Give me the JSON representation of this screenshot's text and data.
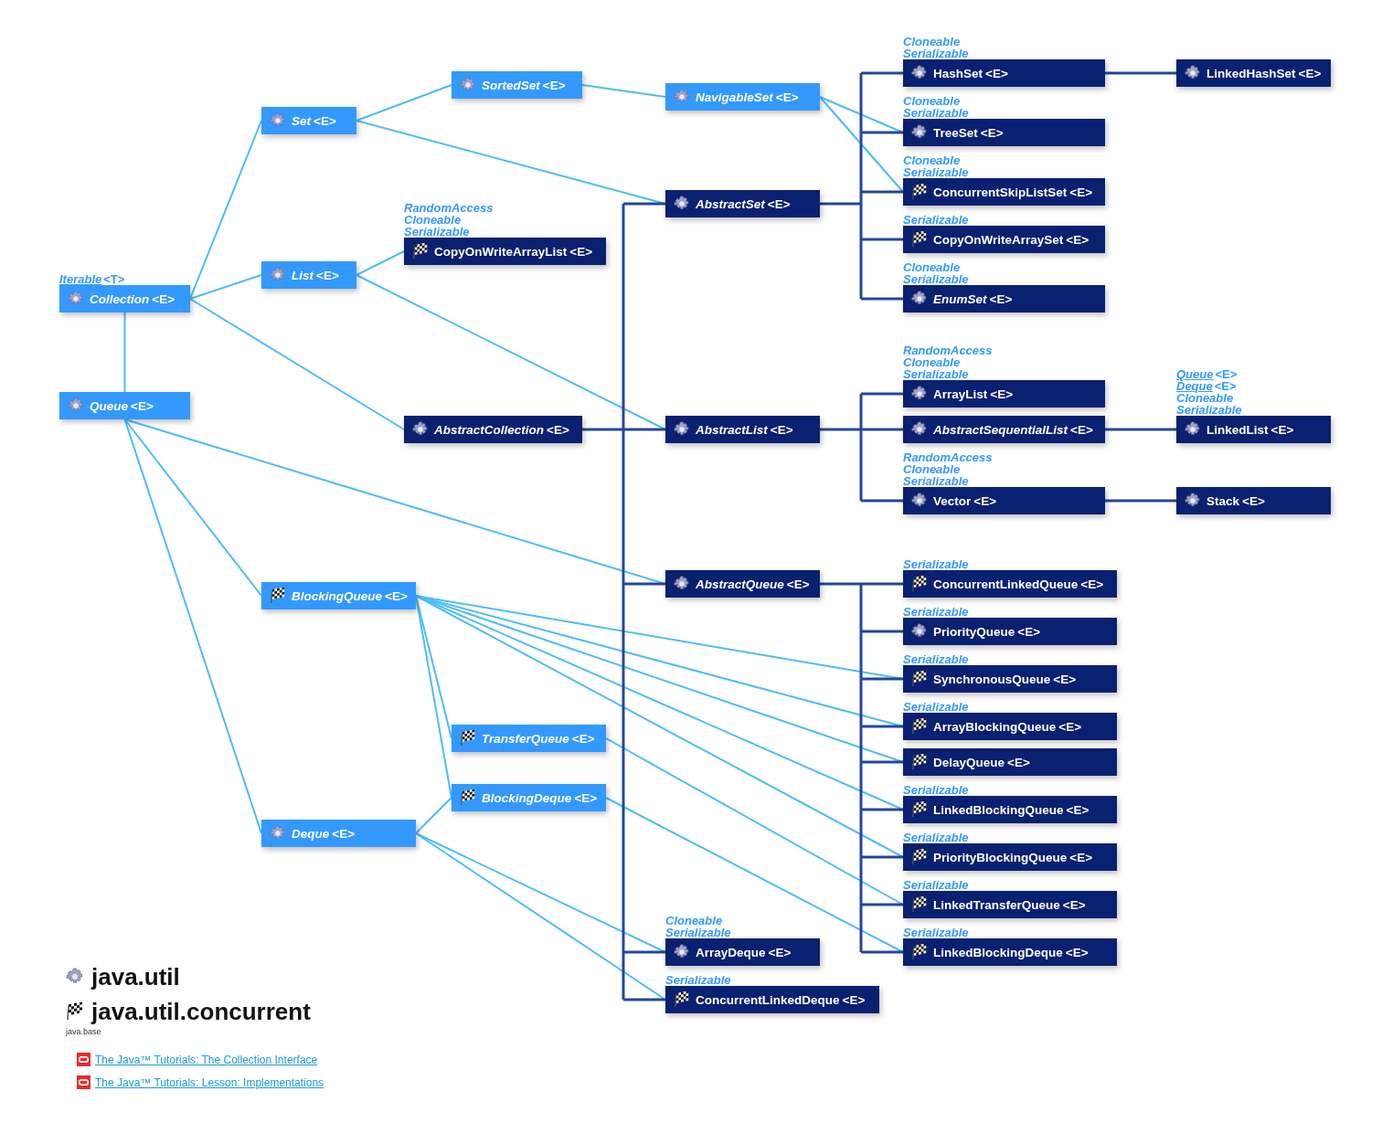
{
  "diagram": {
    "nodes": [
      {
        "name": "Collection",
        "type_params": "<E>",
        "kind": "interface",
        "concurrent": false,
        "supers": [
          {
            "text": "Iterable",
            "type_params": "<T>",
            "linked": true
          }
        ]
      },
      {
        "name": "Queue",
        "type_params": "<E>",
        "kind": "interface",
        "concurrent": false
      },
      {
        "name": "Set",
        "type_params": "<E>",
        "kind": "interface",
        "concurrent": false
      },
      {
        "name": "List",
        "type_params": "<E>",
        "kind": "interface",
        "concurrent": false
      },
      {
        "name": "SortedSet",
        "type_params": "<E>",
        "kind": "interface",
        "concurrent": false
      },
      {
        "name": "NavigableSet",
        "type_params": "<E>",
        "kind": "interface",
        "concurrent": false
      },
      {
        "name": "AbstractSet",
        "type_params": "<E>",
        "kind": "abstract_class",
        "concurrent": false
      },
      {
        "name": "CopyOnWriteArrayList",
        "type_params": "<E>",
        "kind": "class",
        "concurrent": true,
        "supers": [
          {
            "text": "RandomAccess",
            "linked": false
          },
          {
            "text": "Cloneable",
            "linked": false
          },
          {
            "text": "Serializable",
            "linked": false
          }
        ]
      },
      {
        "name": "AbstractCollection",
        "type_params": "<E>",
        "kind": "abstract_class",
        "concurrent": false
      },
      {
        "name": "AbstractList",
        "type_params": "<E>",
        "kind": "abstract_class",
        "concurrent": false
      },
      {
        "name": "AbstractQueue",
        "type_params": "<E>",
        "kind": "abstract_class",
        "concurrent": false
      },
      {
        "name": "BlockingQueue",
        "type_params": "<E>",
        "kind": "interface",
        "concurrent": true
      },
      {
        "name": "TransferQueue",
        "type_params": "<E>",
        "kind": "interface",
        "concurrent": true
      },
      {
        "name": "BlockingDeque",
        "type_params": "<E>",
        "kind": "interface",
        "concurrent": true
      },
      {
        "name": "Deque",
        "type_params": "<E>",
        "kind": "interface",
        "concurrent": false
      },
      {
        "name": "HashSet",
        "type_params": "<E>",
        "kind": "class",
        "concurrent": false,
        "supers": [
          {
            "text": "Cloneable",
            "linked": false
          },
          {
            "text": "Serializable",
            "linked": false
          }
        ]
      },
      {
        "name": "LinkedHashSet",
        "type_params": "<E>",
        "kind": "class",
        "concurrent": false
      },
      {
        "name": "TreeSet",
        "type_params": "<E>",
        "kind": "class",
        "concurrent": false,
        "supers": [
          {
            "text": "Cloneable",
            "linked": false
          },
          {
            "text": "Serializable",
            "linked": false
          }
        ]
      },
      {
        "name": "ConcurrentSkipListSet",
        "type_params": "<E>",
        "kind": "class",
        "concurrent": true,
        "supers": [
          {
            "text": "Cloneable",
            "linked": false
          },
          {
            "text": "Serializable",
            "linked": false
          }
        ]
      },
      {
        "name": "CopyOnWriteArraySet",
        "type_params": "<E>",
        "kind": "class",
        "concurrent": true,
        "supers": [
          {
            "text": "Serializable",
            "linked": false
          }
        ]
      },
      {
        "name": "EnumSet",
        "type_params": "<E>",
        "kind": "abstract_class",
        "concurrent": false,
        "supers": [
          {
            "text": "Cloneable",
            "linked": false
          },
          {
            "text": "Serializable",
            "linked": false
          }
        ]
      },
      {
        "name": "ArrayList",
        "type_params": "<E>",
        "kind": "class",
        "concurrent": false,
        "supers": [
          {
            "text": "RandomAccess",
            "linked": false
          },
          {
            "text": "Cloneable",
            "linked": false
          },
          {
            "text": "Serializable",
            "linked": false
          }
        ]
      },
      {
        "name": "AbstractSequentialList",
        "type_params": "<E>",
        "kind": "abstract_class",
        "concurrent": false
      },
      {
        "name": "LinkedList",
        "type_params": "<E>",
        "kind": "class",
        "concurrent": false,
        "supers": [
          {
            "text": "Queue",
            "type_params": "<E>",
            "linked": true
          },
          {
            "text": "Deque",
            "type_params": "<E>",
            "linked": true
          },
          {
            "text": "Cloneable",
            "linked": false
          },
          {
            "text": "Serializable",
            "linked": false
          }
        ]
      },
      {
        "name": "Vector",
        "type_params": "<E>",
        "kind": "class",
        "concurrent": false,
        "supers": [
          {
            "text": "RandomAccess",
            "linked": false
          },
          {
            "text": "Cloneable",
            "linked": false
          },
          {
            "text": "Serializable",
            "linked": false
          }
        ]
      },
      {
        "name": "Stack",
        "type_params": "<E>",
        "kind": "class",
        "concurrent": false
      },
      {
        "name": "ConcurrentLinkedQueue",
        "type_params": "<E>",
        "kind": "class",
        "concurrent": true,
        "supers": [
          {
            "text": "Serializable",
            "linked": false
          }
        ]
      },
      {
        "name": "PriorityQueue",
        "type_params": "<E>",
        "kind": "class",
        "concurrent": false,
        "supers": [
          {
            "text": "Serializable",
            "linked": false
          }
        ]
      },
      {
        "name": "SynchronousQueue",
        "type_params": "<E>",
        "kind": "class",
        "concurrent": true,
        "supers": [
          {
            "text": "Serializable",
            "linked": false
          }
        ]
      },
      {
        "name": "ArrayBlockingQueue",
        "type_params": "<E>",
        "kind": "class",
        "concurrent": true,
        "supers": [
          {
            "text": "Serializable",
            "linked": false
          }
        ]
      },
      {
        "name": "DelayQueue",
        "type_params": "<E>",
        "kind": "class",
        "concurrent": true
      },
      {
        "name": "LinkedBlockingQueue",
        "type_params": "<E>",
        "kind": "class",
        "concurrent": true,
        "supers": [
          {
            "text": "Serializable",
            "linked": false
          }
        ]
      },
      {
        "name": "PriorityBlockingQueue",
        "type_params": "<E>",
        "kind": "class",
        "concurrent": true,
        "supers": [
          {
            "text": "Serializable",
            "linked": false
          }
        ]
      },
      {
        "name": "LinkedTransferQueue",
        "type_params": "<E>",
        "kind": "class",
        "concurrent": true,
        "supers": [
          {
            "text": "Serializable",
            "linked": false
          }
        ]
      },
      {
        "name": "ArrayDeque",
        "type_params": "<E>",
        "kind": "class",
        "concurrent": false,
        "supers": [
          {
            "text": "Cloneable",
            "linked": false
          },
          {
            "text": "Serializable",
            "linked": false
          }
        ]
      },
      {
        "name": "LinkedBlockingDeque",
        "type_params": "<E>",
        "kind": "class",
        "concurrent": true,
        "supers": [
          {
            "text": "Serializable",
            "linked": false
          }
        ]
      },
      {
        "name": "ConcurrentLinkedDeque",
        "type_params": "<E>",
        "kind": "class",
        "concurrent": true,
        "supers": [
          {
            "text": "Serializable",
            "linked": false
          }
        ]
      }
    ]
  },
  "legend": {
    "packages": [
      {
        "name": "java.util",
        "concurrent": false
      },
      {
        "name": "java.util.concurrent",
        "concurrent": true
      }
    ],
    "module": "java.base"
  },
  "links": [
    {
      "text": "The Java™ Tutorials: The Collection Interface"
    },
    {
      "text": "The Java™ Tutorials: Lesson: Implementations"
    }
  ]
}
